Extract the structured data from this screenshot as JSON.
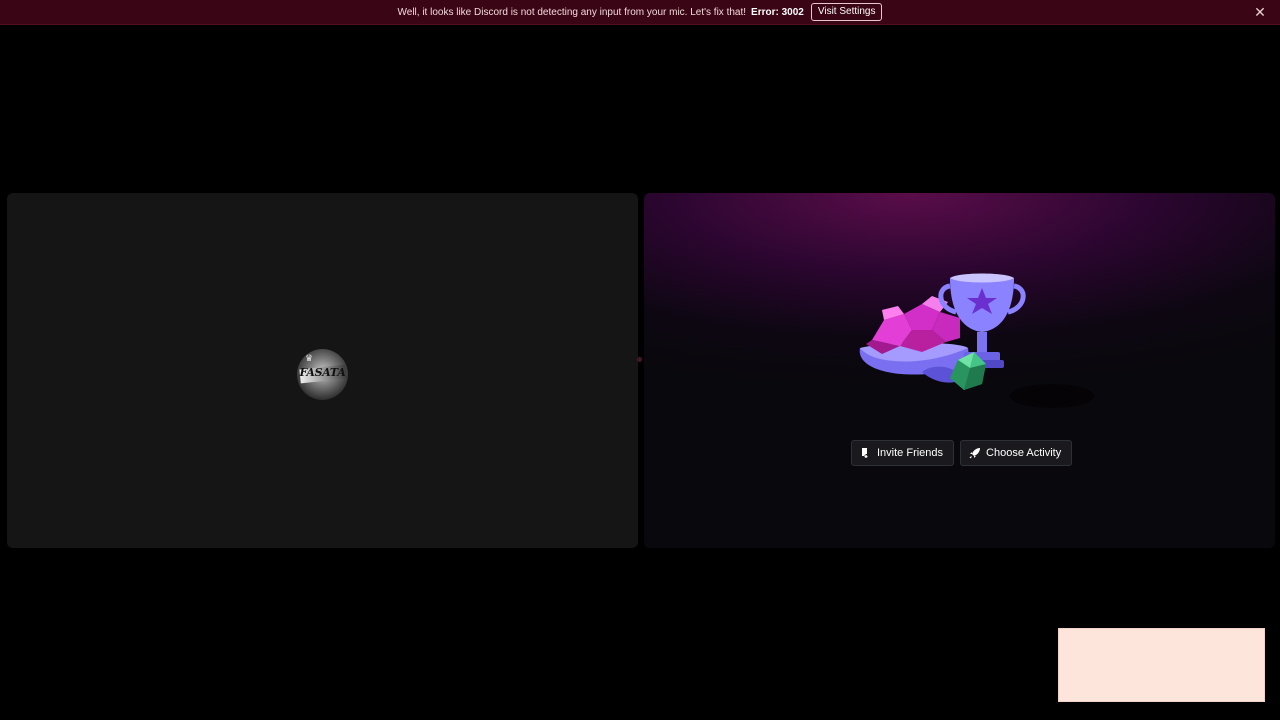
{
  "notice": {
    "message": "Well, it looks like Discord is not detecting any input from your mic. Let's fix that!",
    "error_label": "Error: 3002",
    "visit_label": "Visit Settings",
    "close_glyph": "✕",
    "background": "#3a0514"
  },
  "participant": {
    "avatar_text": "FASATA",
    "avatar_icon": "crown-icon"
  },
  "activity": {
    "invite_label": "Invite Friends",
    "invite_icon": "add-friend-icon",
    "choose_label": "Choose Activity",
    "choose_icon": "rocket-icon",
    "hero_icons": [
      "gem-pile-icon",
      "trophy-icon",
      "d20-dice-icon"
    ]
  },
  "colors": {
    "page_bg": "#000000",
    "tile_bg": "#151515",
    "accent_purple": "#5a0d4a",
    "pip_bg": "#fde5dc"
  }
}
